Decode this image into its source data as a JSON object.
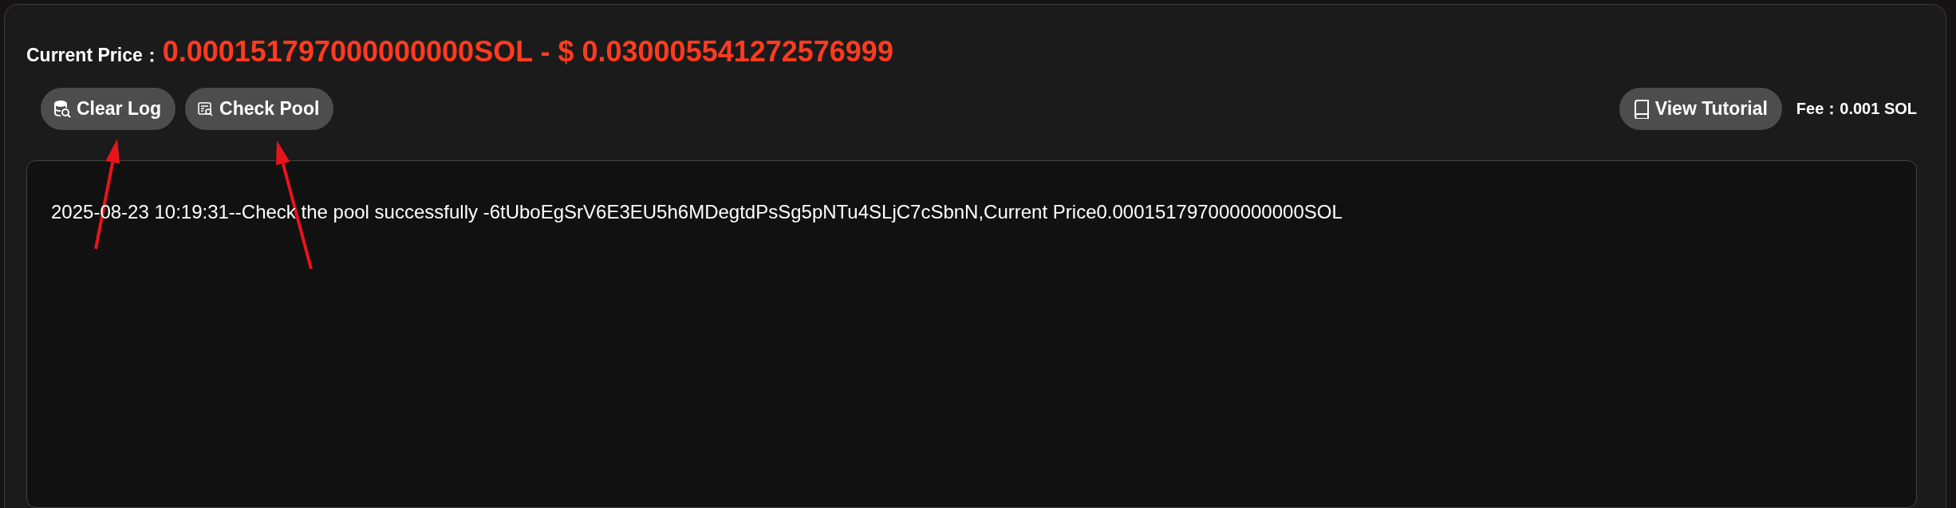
{
  "price": {
    "label": "Current Price：",
    "value": "0.000151797000000000SOL - $ 0.030005541272576999"
  },
  "toolbar": {
    "left": [
      {
        "kind": "database",
        "label": "Clear Log"
      },
      {
        "kind": "list",
        "label": "Check Pool"
      }
    ],
    "right": [
      {
        "kind": "book",
        "label": "View Tutorial"
      }
    ],
    "fee": {
      "label": "Fee：",
      "value": "0.001 SOL"
    }
  },
  "log": [
    "2025-08-23 10:19:31--Check the pool successfully -6tUboEgSrV6E3EU5h6MDegtdPsSg5pNTu4SLjC7cSbnN,Current Price0.000151797000000000SOL"
  ],
  "annotations": [
    {
      "kind": "arrow"
    },
    {
      "kind": "arrow"
    }
  ]
}
